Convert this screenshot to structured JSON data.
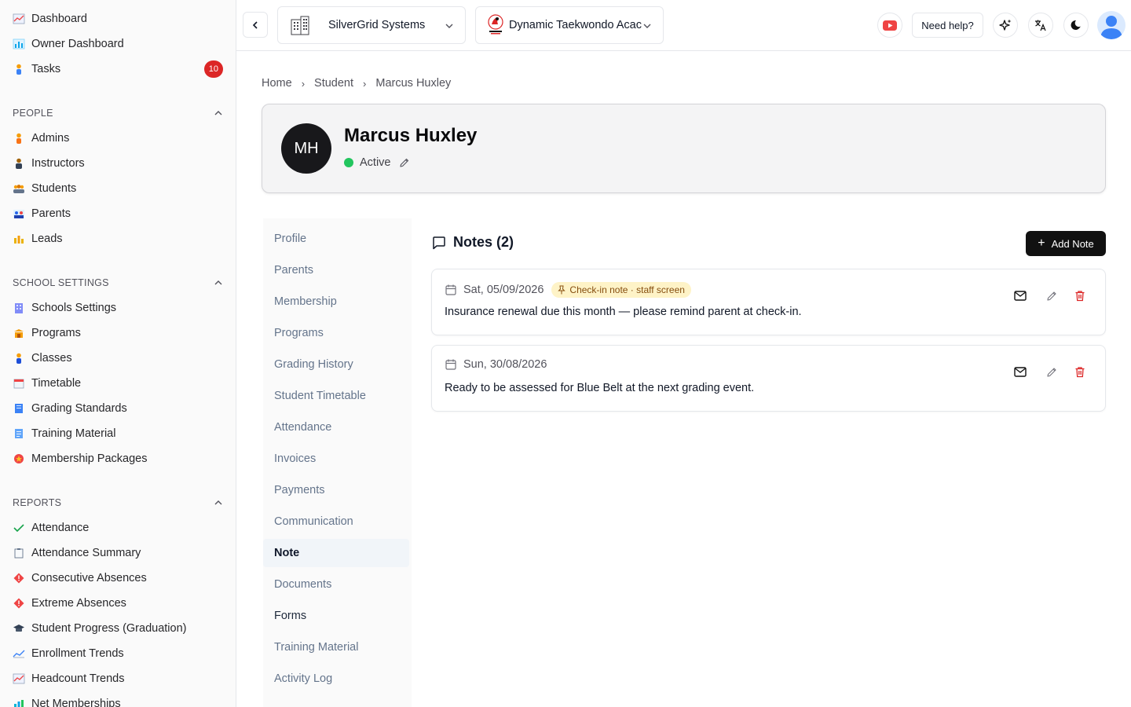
{
  "sidebar": {
    "top_items": [
      {
        "label": "Dashboard",
        "icon": "chart-icon"
      },
      {
        "label": "Owner Dashboard",
        "icon": "bar-chart-icon"
      },
      {
        "label": "Tasks",
        "icon": "person-icon",
        "badge": "10"
      }
    ],
    "sections": [
      {
        "title": "PEOPLE",
        "items": [
          {
            "label": "Admins"
          },
          {
            "label": "Instructors"
          },
          {
            "label": "Students"
          },
          {
            "label": "Parents"
          },
          {
            "label": "Leads"
          }
        ]
      },
      {
        "title": "SCHOOL SETTINGS",
        "items": [
          {
            "label": "Schools Settings"
          },
          {
            "label": "Programs"
          },
          {
            "label": "Classes"
          },
          {
            "label": "Timetable"
          },
          {
            "label": "Grading Standards"
          },
          {
            "label": "Training Material"
          },
          {
            "label": "Membership Packages"
          }
        ]
      },
      {
        "title": "REPORTS",
        "items": [
          {
            "label": "Attendance"
          },
          {
            "label": "Attendance Summary"
          },
          {
            "label": "Consecutive Absences"
          },
          {
            "label": "Extreme Absences"
          },
          {
            "label": "Student Progress (Graduation)"
          },
          {
            "label": "Enrollment Trends"
          },
          {
            "label": "Headcount Trends"
          },
          {
            "label": "Net Memberships"
          }
        ]
      }
    ]
  },
  "topbar": {
    "org_select": "SilverGrid Systems",
    "school_select": "Dynamic Taekwondo Acac",
    "help_label": "Need help?",
    "colors": {
      "youtube": "#ef4444"
    }
  },
  "breadcrumb": [
    "Home",
    "Student",
    "Marcus Huxley"
  ],
  "profile": {
    "initials": "MH",
    "name": "Marcus Huxley",
    "status": "Active",
    "status_color": "#22c55e"
  },
  "subnav": [
    "Profile",
    "Parents",
    "Membership",
    "Programs",
    "Grading History",
    "Student Timetable",
    "Attendance",
    "Invoices",
    "Payments",
    "Communication",
    "Note",
    "Documents",
    "Forms",
    "Training Material",
    "Activity Log"
  ],
  "subnav_active": "Note",
  "notes": {
    "title": "Notes (2)",
    "add_label": "Add Note",
    "items": [
      {
        "date": "Sat, 05/09/2026",
        "tag": "Check-in note · staff screen",
        "text": "Insurance renewal due this month — please remind parent at check-in."
      },
      {
        "date": "Sun, 30/08/2026",
        "tag": "",
        "text": "Ready to be assessed for Blue Belt at the next grading event."
      }
    ]
  }
}
